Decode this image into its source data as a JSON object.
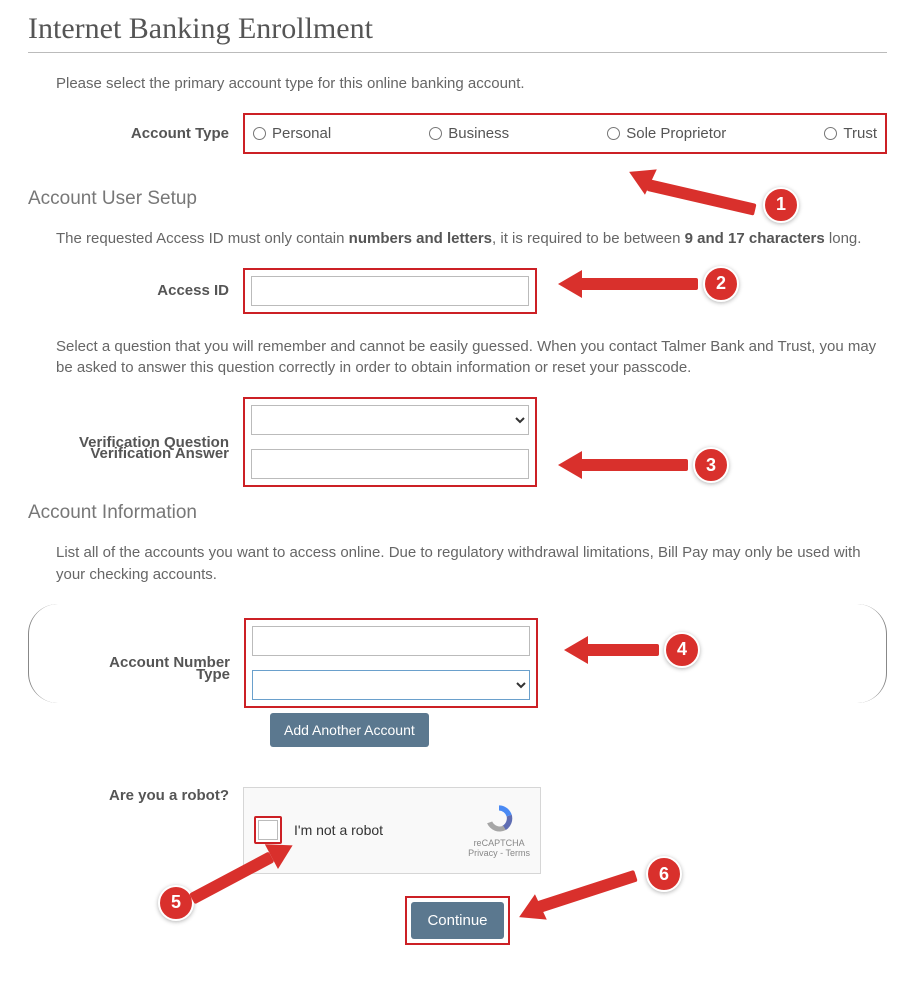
{
  "page_title": "Internet Banking Enrollment",
  "intro_text": "Please select the primary account type for this online banking account.",
  "account_type": {
    "label": "Account Type",
    "options": [
      "Personal",
      "Business",
      "Sole Proprietor",
      "Trust"
    ]
  },
  "sections": {
    "user_setup": {
      "heading": "Account User Setup",
      "access_id_instr_pre": "The requested Access ID must only contain ",
      "access_id_instr_bold1": "numbers and letters",
      "access_id_instr_mid": ", it is required to be between ",
      "access_id_instr_bold2": "9 and 17 characters",
      "access_id_instr_post": " long.",
      "access_id_label": "Access ID",
      "verify_instr": "Select a question that you will remember and cannot be easily guessed. When you contact Talmer Bank and Trust, you may be asked to answer this question correctly in order to obtain information or reset your passcode.",
      "verify_q_label": "Verification Question",
      "verify_a_label": "Verification Answer"
    },
    "account_info": {
      "heading": "Account Information",
      "instr": "List all of the accounts you want to access online. Due to regulatory withdrawal limitations, Bill Pay may only be used with your checking accounts.",
      "account_number_label": "Account Number",
      "type_label": "Type",
      "add_button": "Add Another Account"
    },
    "robot": {
      "label": "Are you a robot?",
      "checkbox_label": "I'm not a robot",
      "brand": "reCAPTCHA",
      "legal": "Privacy - Terms"
    }
  },
  "continue_label": "Continue",
  "annotations": {
    "1": "1",
    "2": "2",
    "3": "3",
    "4": "4",
    "5": "5",
    "6": "6"
  }
}
